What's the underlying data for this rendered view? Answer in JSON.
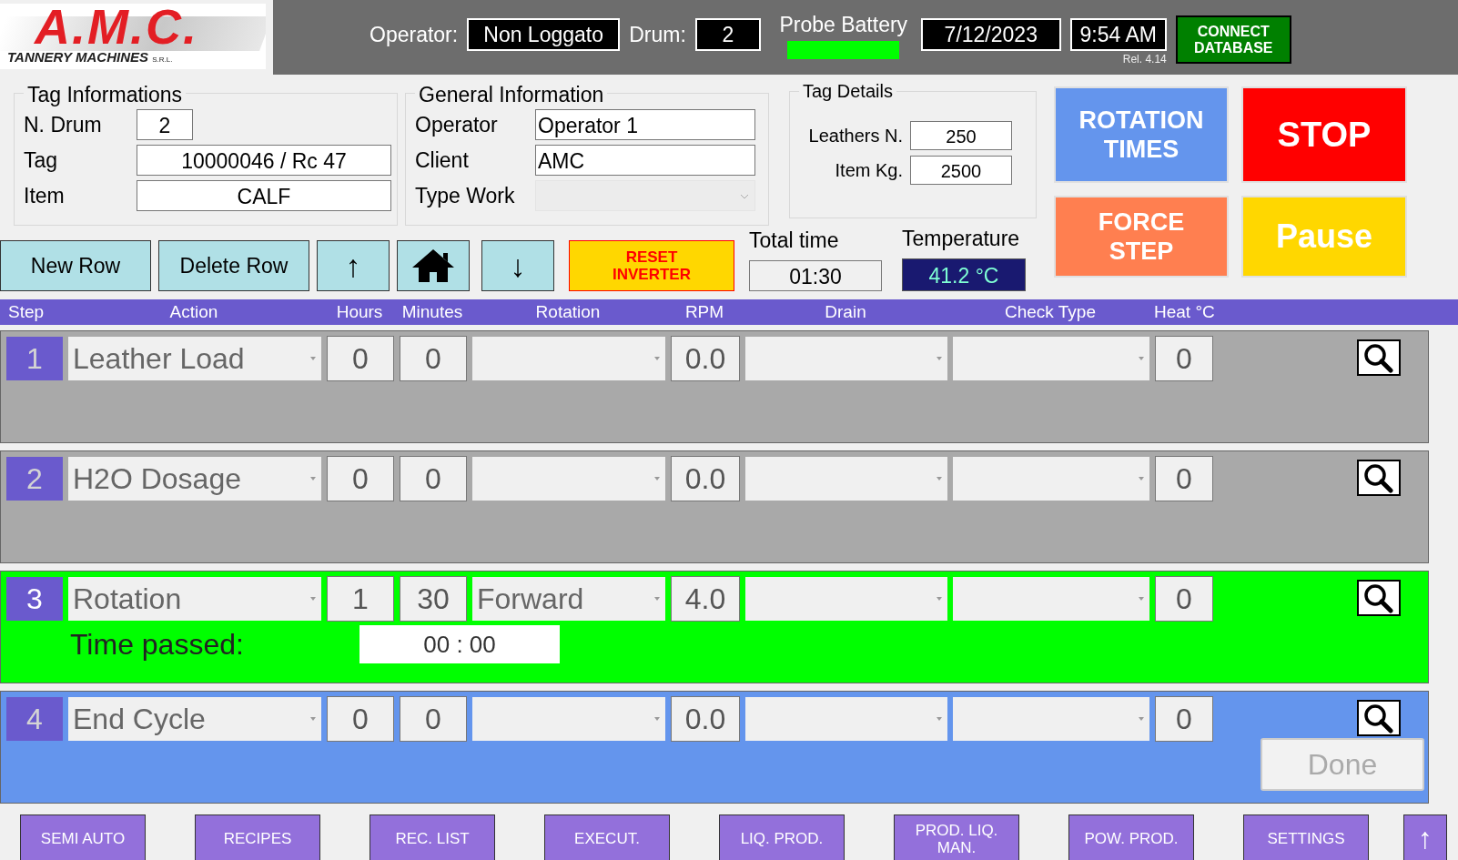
{
  "header": {
    "logo": {
      "title": "A.M.C.",
      "subtitle": "TANNERY MACHINES",
      "suffix": "S.R.L."
    },
    "operator_label": "Operator:",
    "operator_value": "Non Loggato",
    "drum_label": "Drum:",
    "drum_value": "2",
    "battery": {
      "label": "Probe Battery"
    },
    "date": "7/12/2023",
    "time": "9:54 AM",
    "release": "Rel. 4.14",
    "connect_button": "CONNECT DATABASE"
  },
  "tag_informations": {
    "title": "Tag Informations",
    "fields": [
      {
        "label": "N. Drum",
        "value": "2",
        "kind": "short"
      },
      {
        "label": "Tag",
        "value": "10000046 / Rc 47",
        "kind": "wide"
      },
      {
        "label": "Item",
        "value": "CALF",
        "kind": "wide"
      }
    ]
  },
  "general_information": {
    "title": "General Information",
    "fields": [
      {
        "label": "Operator",
        "value": "Operator 1",
        "kind": "text"
      },
      {
        "label": "Client",
        "value": "AMC",
        "kind": "text"
      },
      {
        "label": "Type Work",
        "kind": "combo"
      }
    ]
  },
  "tag_details": {
    "title": "Tag Details",
    "fields": [
      {
        "label": "Leathers N.",
        "value": "250"
      },
      {
        "label": "Item Kg.",
        "value": "2500"
      }
    ]
  },
  "action_buttons": [
    {
      "label": "ROTATION TIMES",
      "color": "#6495ed"
    },
    {
      "label": "STOP",
      "color": "#ff0000"
    },
    {
      "label": "FORCE STEP",
      "color": "#ff7f50"
    },
    {
      "label": "Pause",
      "color": "#ffd700"
    }
  ],
  "toolbar": [
    {
      "kind": "text",
      "label": "New Row"
    },
    {
      "kind": "text",
      "label": "Delete Row"
    },
    {
      "kind": "arrow",
      "label": "↑"
    },
    {
      "kind": "home"
    },
    {
      "kind": "arrow",
      "label": "↓"
    },
    {
      "kind": "warning",
      "label": "RESET INVERTER"
    }
  ],
  "total_time": {
    "label": "Total time",
    "value": "01:30"
  },
  "temperature": {
    "label": "Temperature",
    "value": "41.2 °C"
  },
  "columns": [
    "Step",
    "Action",
    "Hours",
    "Minutes",
    "Rotation",
    "RPM",
    "Drain",
    "Check Type",
    "Heat °C"
  ],
  "steps": [
    {
      "number": "1",
      "action": "Leather Load",
      "hours": "0",
      "minutes": "0",
      "rpm": "0.0",
      "heat": "0",
      "kind": "completed"
    },
    {
      "number": "2",
      "action": "H2O Dosage",
      "hours": "0",
      "minutes": "0",
      "rpm": "0.0",
      "heat": "0",
      "kind": "completed"
    },
    {
      "number": "3",
      "action": "Rotation",
      "hours": "1",
      "minutes": "30",
      "rotation": "Forward",
      "rpm": "4.0",
      "heat": "0",
      "kind": "running",
      "time_passed": {
        "label": "Time passed:",
        "value": "00 : 00"
      }
    },
    {
      "number": "4",
      "action": "End Cycle",
      "hours": "0",
      "minutes": "0",
      "rpm": "0.0",
      "heat": "0",
      "kind": "pending",
      "done_button": {
        "label": "Done",
        "disabled": true
      }
    }
  ],
  "nav": [
    {
      "label": "SEMI AUTO",
      "kind": "text"
    },
    {
      "label": "RECIPES",
      "kind": "text"
    },
    {
      "label": "REC. LIST",
      "kind": "text"
    },
    {
      "label": "EXECUT.",
      "kind": "text"
    },
    {
      "label": "LIQ. PROD.",
      "kind": "text"
    },
    {
      "label": "PROD. LIQ. MAN.",
      "kind": "text"
    },
    {
      "label": "POW. PROD.",
      "kind": "text"
    },
    {
      "label": "SETTINGS",
      "kind": "text"
    },
    {
      "label": "↑",
      "kind": "arrow"
    }
  ]
}
